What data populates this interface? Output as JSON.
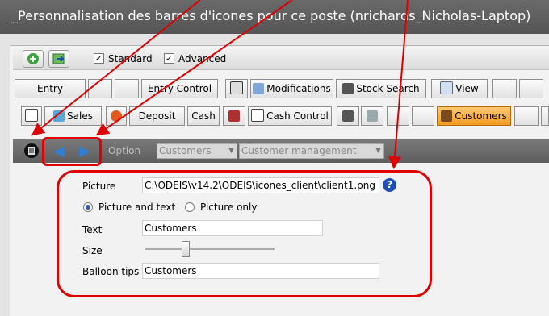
{
  "window": {
    "title": "_Personnalisation des barres d'icones pour ce poste (nrichards_Nicholas-Laptop)"
  },
  "checkboxes": [
    {
      "label": "Standard",
      "checked": true
    },
    {
      "label": "Advanced",
      "checked": true
    }
  ],
  "toolbar1": {
    "entry": "Entry",
    "entry_control": "Entry Control",
    "modifications": "Modifications",
    "stock_search": "Stock Search",
    "view": "View"
  },
  "toolbar2": {
    "sales": "Sales",
    "deposit": "Deposit",
    "cash": "Cash",
    "cash_control": "Cash Control",
    "customers": "Customers"
  },
  "option_bar": {
    "label": "Option",
    "select1_value": "Customers",
    "select2_value": "Customer management"
  },
  "form": {
    "picture_label": "Picture",
    "picture_value": "C:\\ODEIS\\v14.2\\ODEIS\\icones_client\\client1.png",
    "help_glyph": "?",
    "radio_picture_text": "Picture and text",
    "radio_picture_only": "Picture only",
    "text_label": "Text",
    "text_value": "Customers",
    "size_label": "Size",
    "size_level": 0.3,
    "balloon_label": "Balloon tips",
    "balloon_value": "Customers"
  },
  "colors": {
    "highlight": "#e00000",
    "accent": "#2f7fd6",
    "active": "#f39a1f"
  },
  "icons": [
    "add-icon",
    "export-icon",
    "toolbar-icon",
    "left-arrow-icon",
    "right-arrow-icon",
    "help-icon"
  ]
}
